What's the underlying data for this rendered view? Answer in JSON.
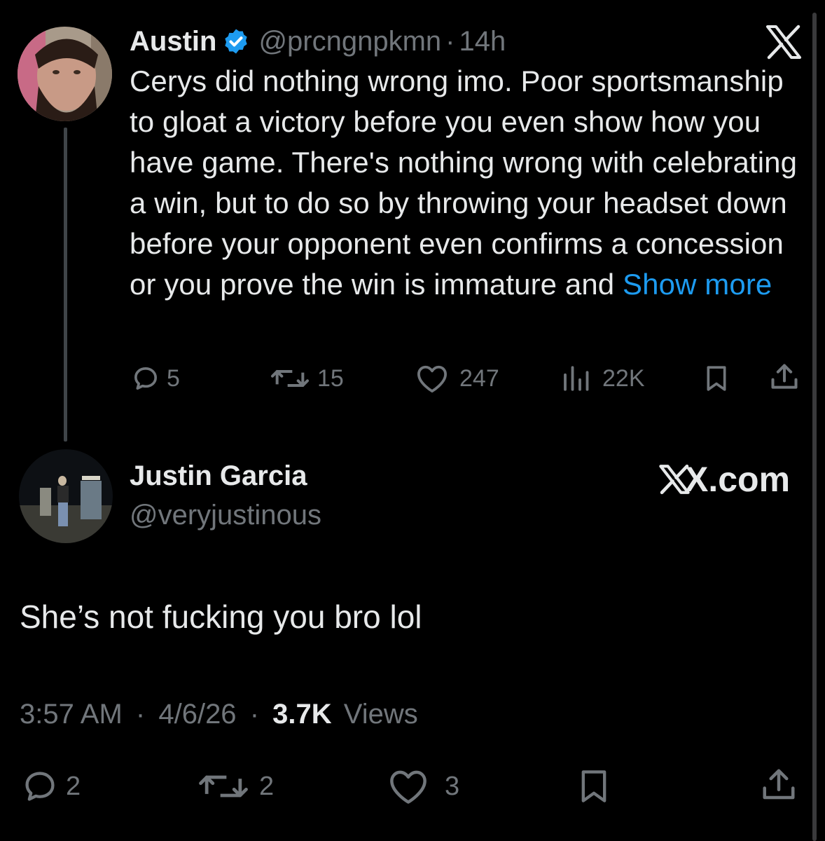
{
  "quoted": {
    "name": "Austin",
    "handle": "@prcngnpkmn",
    "dot": "·",
    "time": "14h",
    "text": "Cerys did nothing wrong imo. Poor sportsmanship to gloat a victory before you even show how you have game. There's nothing wrong with celebrating a win, but to do so by throwing your headset down before your opponent even confirms a concession or you prove the win is immature and",
    "show_more": "Show more",
    "replies": "5",
    "reposts": "15",
    "likes": "247",
    "views": "22K"
  },
  "reply": {
    "name": "Justin Garcia",
    "handle": "@veryjustinous",
    "brand": "X.com",
    "text": "She’s not fucking you bro lol",
    "time": "3:57 AM",
    "sep": "·",
    "date": "4/6/26",
    "views_count": "3.7K",
    "views_label": "Views",
    "replies": "2",
    "reposts": "2",
    "likes": "3"
  },
  "colors": {
    "accent": "#1d9bf0",
    "muted": "#71767b",
    "text": "#e7e9ea",
    "verified": "#1d9bf0"
  }
}
